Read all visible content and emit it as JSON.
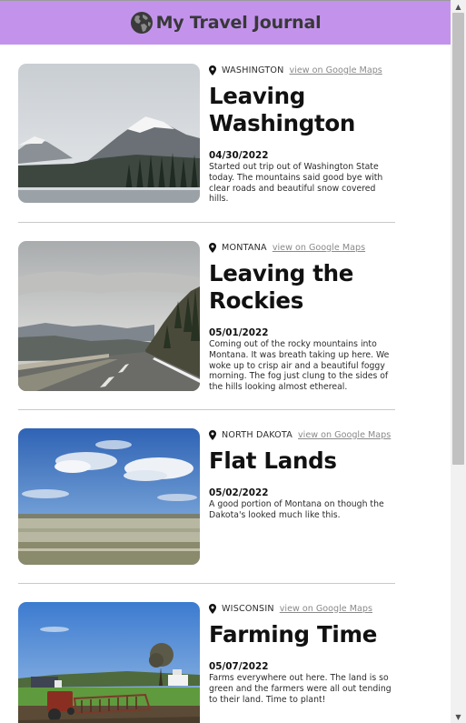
{
  "header": {
    "title": "My Travel Journal",
    "icon": "globe-icon",
    "bg_color": "#c393ec"
  },
  "entries": [
    {
      "location": "WASHINGTON",
      "maps_link": "view on Google Maps",
      "title": "Leaving Washington",
      "date": "04/30/2022",
      "description": "Started out trip out of Washington State today. The mountains said good bye with clear roads and beautiful snow covered hills."
    },
    {
      "location": "MONTANA",
      "maps_link": "view on Google Maps",
      "title": "Leaving the Rockies",
      "date": "05/01/2022",
      "description": "Coming out of the rocky mountains into Montana. It was breath taking up here. We woke up to crisp air and a beautiful foggy morning. The fog just clung to the sides of the hills looking almost ethereal."
    },
    {
      "location": "NORTH DAKOTA",
      "maps_link": "view on Google Maps",
      "title": "Flat Lands",
      "date": "05/02/2022",
      "description": "A good portion of Montana on though the Dakota's looked much like this."
    },
    {
      "location": "WISCONSIN",
      "maps_link": "view on Google Maps",
      "title": "Farming Time",
      "date": "05/07/2022",
      "description": "Farms everywhere out here. The land is so green and the farmers were all out tending to their land. Time to plant!"
    }
  ],
  "icons": {
    "location": "location-pin-icon",
    "scroll_up": "arrow-up-icon",
    "scroll_down": "arrow-down-icon"
  }
}
